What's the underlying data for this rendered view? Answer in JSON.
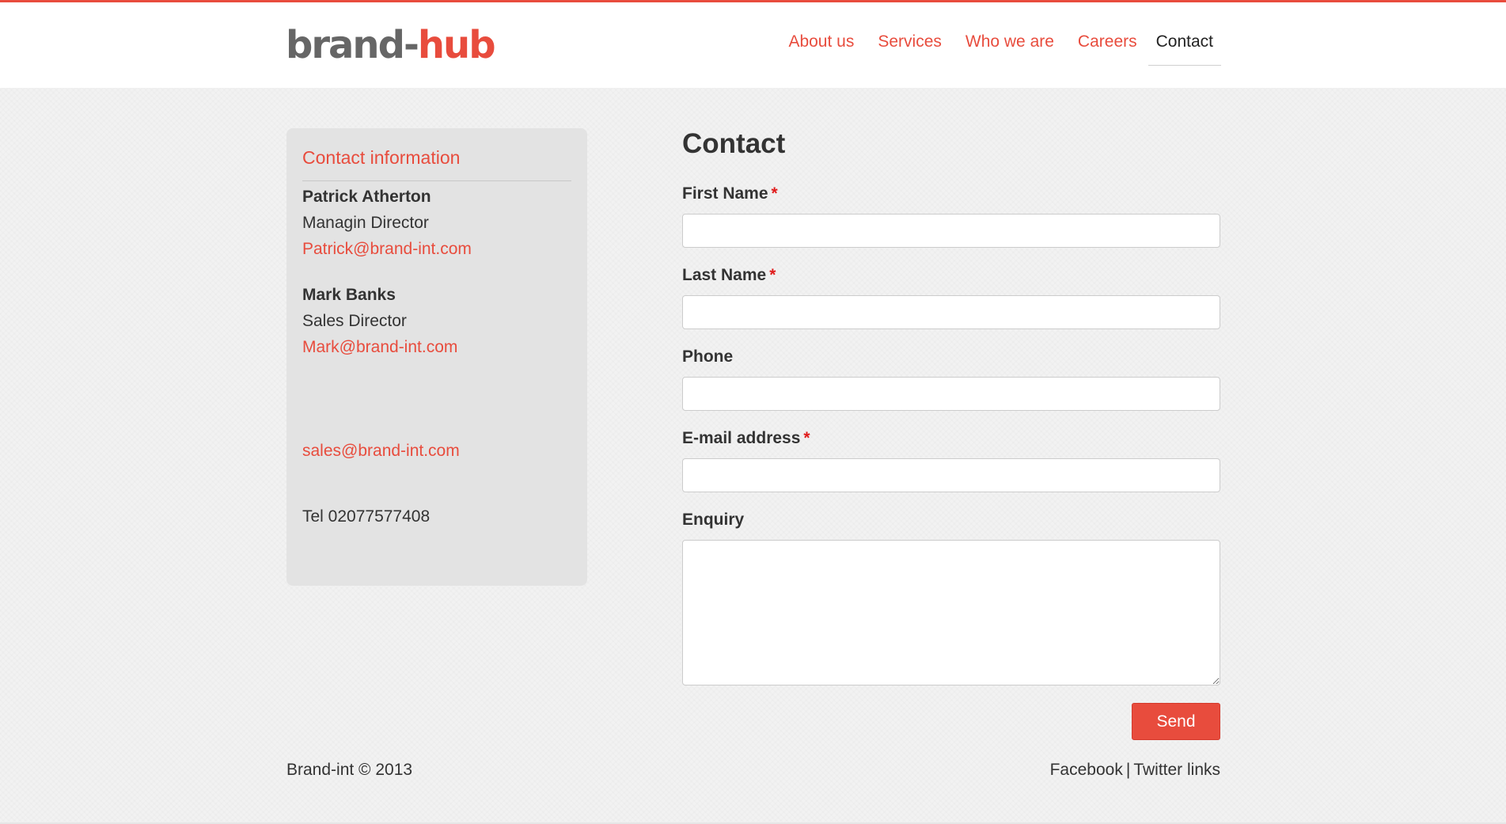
{
  "header": {
    "logo_part1": "brand-",
    "logo_part2": "hub",
    "nav": [
      {
        "label": "About us"
      },
      {
        "label": "Services"
      },
      {
        "label": "Who we are"
      },
      {
        "label": "Careers"
      },
      {
        "label": "Contact"
      }
    ],
    "active_nav": "Contact"
  },
  "sidebar": {
    "title": "Contact information",
    "contacts": [
      {
        "name": "Patrick Atherton",
        "role": "Managin Director",
        "email": "Patrick@brand-int.com"
      },
      {
        "name": "Mark Banks",
        "role": "Sales Director",
        "email": "Mark@brand-int.com"
      }
    ],
    "general_email": "sales@brand-int.com",
    "tel": "Tel 02077577408"
  },
  "form": {
    "title": "Contact",
    "fields": [
      {
        "label": "First Name",
        "required": true,
        "value": ""
      },
      {
        "label": "Last Name",
        "required": true,
        "value": ""
      },
      {
        "label": "Phone",
        "required": false,
        "value": ""
      },
      {
        "label": "E-mail address",
        "required": true,
        "value": ""
      },
      {
        "label": "Enquiry",
        "required": false,
        "value": ""
      }
    ],
    "required_marker": "*",
    "submit_label": "Send"
  },
  "footer": {
    "copyright": "Brand-int © 2013",
    "facebook": "Facebook",
    "separator": "|",
    "twitter": "Twitter links"
  },
  "colors": {
    "accent": "#e84c3d",
    "text": "#333333",
    "background": "#f2f2f2",
    "sidebar_bg": "#e3e3e3"
  }
}
